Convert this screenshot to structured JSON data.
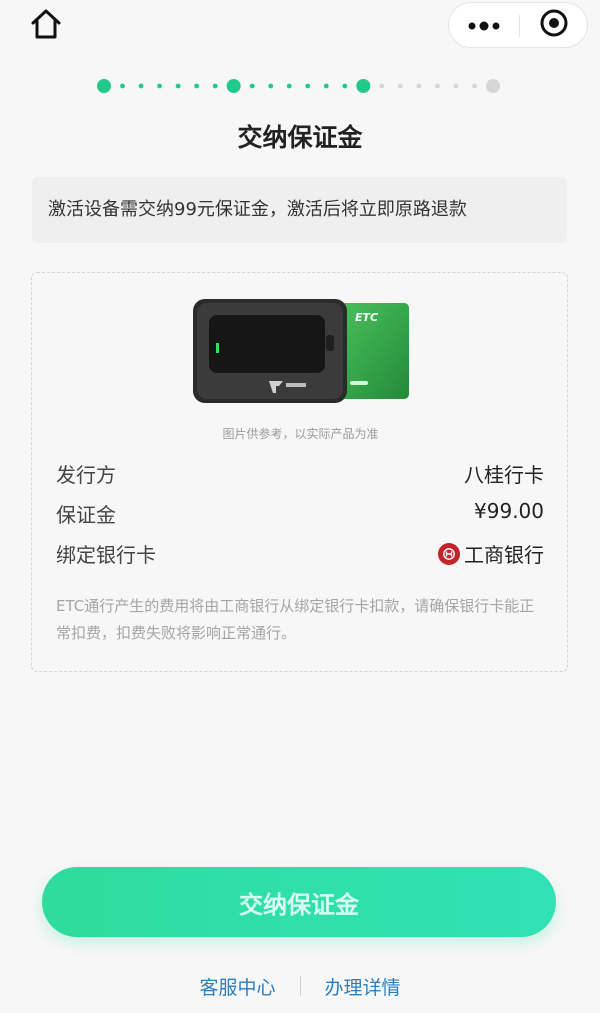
{
  "nav": {
    "home_icon": "home-icon",
    "more_icon": "more-dots-icon",
    "target_icon": "close-target-icon"
  },
  "steps": {
    "total": 4,
    "current": 3,
    "active_color": "#22c98b",
    "inactive_color": "#d6d6d6"
  },
  "page": {
    "title": "交纳保证金",
    "notice": "激活设备需交纳99元保证金，激活后将立即原路退款"
  },
  "card": {
    "device_card_text": "ETC",
    "image_caption": "图片供参考，以实际产品为准",
    "rows": [
      {
        "label": "发行方",
        "value": "八桂行卡"
      },
      {
        "label": "保证金",
        "value": "¥99.00"
      },
      {
        "label": "绑定银行卡",
        "value": "工商银行"
      }
    ],
    "disclaimer": "ETC通行产生的费用将由工商银行从绑定银行卡扣款，请确保银行卡能正常扣费，扣费失败将影响正常通行。"
  },
  "actions": {
    "pay_label": "交纳保证金",
    "customer_service": "客服中心",
    "details": "办理详情"
  },
  "colors": {
    "accent_green": "#30e2b5",
    "link_blue": "#2c7fbf",
    "bank_red": "#c2242b"
  }
}
